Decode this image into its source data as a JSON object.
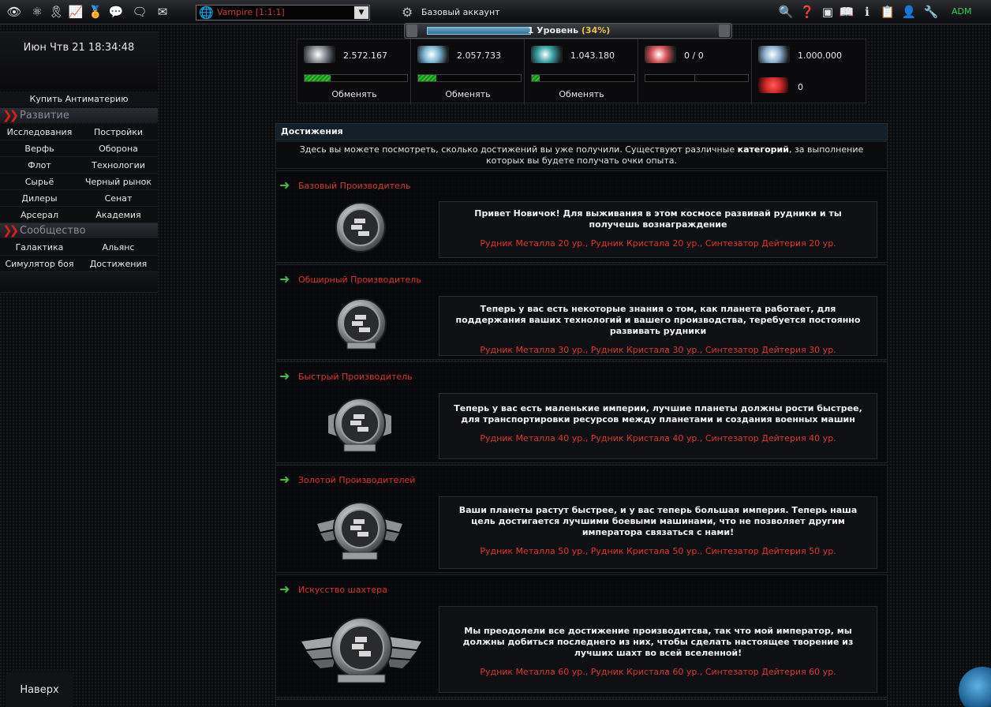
{
  "topbar": {
    "icons": [
      "eye-icon",
      "atom-icon",
      "ribbon-icon",
      "chart-icon",
      "medal-icon",
      "chat-icon",
      "message-icon",
      "mail-icon"
    ],
    "right_icons": [
      "search-icon",
      "help-icon",
      "crop-icon",
      "book-icon",
      "info-icon",
      "notes-icon",
      "user-icon",
      "tools-icon"
    ],
    "planet": "Vampire [1:1:1]",
    "account": "Базовый аккаунт",
    "admin": "ADM"
  },
  "level": {
    "label": "1 Уровень",
    "percent_text": "(34%)",
    "progress": 0.34
  },
  "resources": [
    {
      "value": "2.572.167",
      "fill": 0.25,
      "action": "Обменять",
      "color": "#8a9096"
    },
    {
      "value": "2.057.733",
      "fill": 0.18,
      "action": "Обменять",
      "color": "#7fb7d6"
    },
    {
      "value": "1.043.180",
      "fill": 0.08,
      "action": "Обменять",
      "color": "#3aa5a8"
    },
    {
      "value": "0 / 0",
      "fill": 0.0,
      "action": "",
      "color": "#d8565a"
    },
    {
      "value": "1.000.000",
      "value2": "0",
      "color": "#8fb3d2",
      "color2": "#d12a2a"
    }
  ],
  "sidebar": {
    "clock": "Июн Чтв 21 18:34:48",
    "buy": "Купить Антиматерию",
    "sections": [
      {
        "title": "Развитие",
        "items": [
          "Исследования",
          "Постройки",
          "Верфь",
          "Оборона",
          "Флот",
          "Технологии",
          "Сырьё",
          "Черный рынок",
          "Дилеры",
          "Сенат",
          "Арсерал",
          "Академия"
        ]
      },
      {
        "title": "Сообщество",
        "items": [
          "Галактика",
          "Альянс",
          "Симулятор боя",
          "Достижения"
        ]
      }
    ],
    "to_top": "Наверх"
  },
  "page": {
    "title": "Достижения",
    "intro_before": "Здесь вы можете посмотреть, сколько достижений вы уже получили. Существуют различные ",
    "intro_bold": "категорий",
    "intro_after": ", за выполнение которых вы будете получать очки опыта."
  },
  "achievements": [
    {
      "name": "Базовый Производитель",
      "text": "Привет Новичок! Для выживания в этом космосе развивай рудники и ты получешь вознаграждение",
      "req": "Рудник Металла 20 ур., Рудник Кристала 20 ур., Синтезатор Дейтерия 20 ур."
    },
    {
      "name": "Обширный Производитель",
      "text": "Теперь у вас есть некоторые знания о том, как планета работает, для поддержания ваших технологий и вашего производства, теребуется постоянно развивать рудники",
      "req": "Рудник Металла 30 ур., Рудник Кристала 30 ур., Синтезатор Дейтерия 30 ур."
    },
    {
      "name": "Быстрый Производитель",
      "text": "Теперь у вас есть маленькие империи, лучшие планеты должны рости быстрее, для транспортировки ресурсов между планетами и создания военных машин",
      "req": "Рудник Металла 40 ур., Рудник Кристала 40 ур., Синтезатор Дейтерия 40 ур."
    },
    {
      "name": "Золотой Производителей",
      "text": "Ваши планеты растут быстрее, и у вас теперь большая империя. Теперь наша цель достигается лучшими боевыми машинами, что не позволяет другим императора связаться с нами!",
      "req": "Рудник Металла 50 ур., Рудник Кристала 50 ур., Синтезатор Дейтерия 50 ур."
    },
    {
      "name": "Искусство шахтера",
      "text": "Мы преодолели все достижение производитсва, так что мой император, мы должны добиться последнего из них, чтобы сделать настоящее творение из лучших шахт во всей вселенной!",
      "req": "Рудник Металла 60 ур., Рудник Кристала 60 ур., Синтезатор Дейтерия 60 ур."
    }
  ]
}
